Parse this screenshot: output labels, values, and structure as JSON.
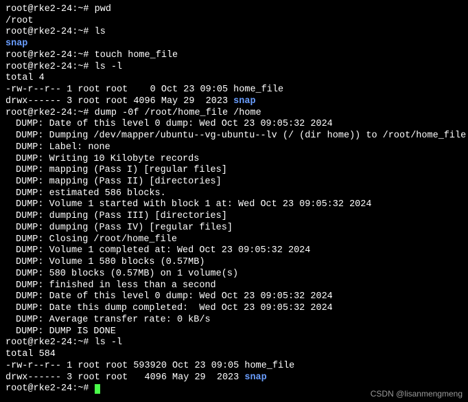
{
  "prompt": "root@rke2-24:~# ",
  "commands": {
    "pwd": "pwd",
    "pwd_out": "/root",
    "ls": "ls",
    "touch": "touch home_file",
    "lsl_1": "ls -l",
    "dump": "dump -0f /root/home_file /home",
    "lsl_2": "ls -l"
  },
  "snap": "snap",
  "listing1": {
    "total": "total 4",
    "row1": "-rw-r--r-- 1 root root    0 Oct 23 09:05 home_file",
    "row2_prefix": "drwx------ 3 root root 4096 May 29  2023 "
  },
  "dump_lines": [
    "DUMP: Date of this level 0 dump: Wed Oct 23 09:05:32 2024",
    "DUMP: Dumping /dev/mapper/ubuntu--vg-ubuntu--lv (/ (dir home)) to /root/home_file",
    "DUMP: Label: none",
    "DUMP: Writing 10 Kilobyte records",
    "DUMP: mapping (Pass I) [regular files]",
    "DUMP: mapping (Pass II) [directories]",
    "DUMP: estimated 586 blocks.",
    "DUMP: Volume 1 started with block 1 at: Wed Oct 23 09:05:32 2024",
    "DUMP: dumping (Pass III) [directories]",
    "DUMP: dumping (Pass IV) [regular files]",
    "DUMP: Closing /root/home_file",
    "DUMP: Volume 1 completed at: Wed Oct 23 09:05:32 2024",
    "DUMP: Volume 1 580 blocks (0.57MB)",
    "DUMP: 580 blocks (0.57MB) on 1 volume(s)",
    "DUMP: finished in less than a second",
    "DUMP: Date of this level 0 dump: Wed Oct 23 09:05:32 2024",
    "DUMP: Date this dump completed:  Wed Oct 23 09:05:32 2024",
    "DUMP: Average transfer rate: 0 kB/s",
    "DUMP: DUMP IS DONE"
  ],
  "listing2": {
    "total": "total 584",
    "row1": "-rw-r--r-- 1 root root 593920 Oct 23 09:05 home_file",
    "row2_prefix": "drwx------ 3 root root   4096 May 29  2023 "
  },
  "watermark": "CSDN @lisanmengmeng"
}
